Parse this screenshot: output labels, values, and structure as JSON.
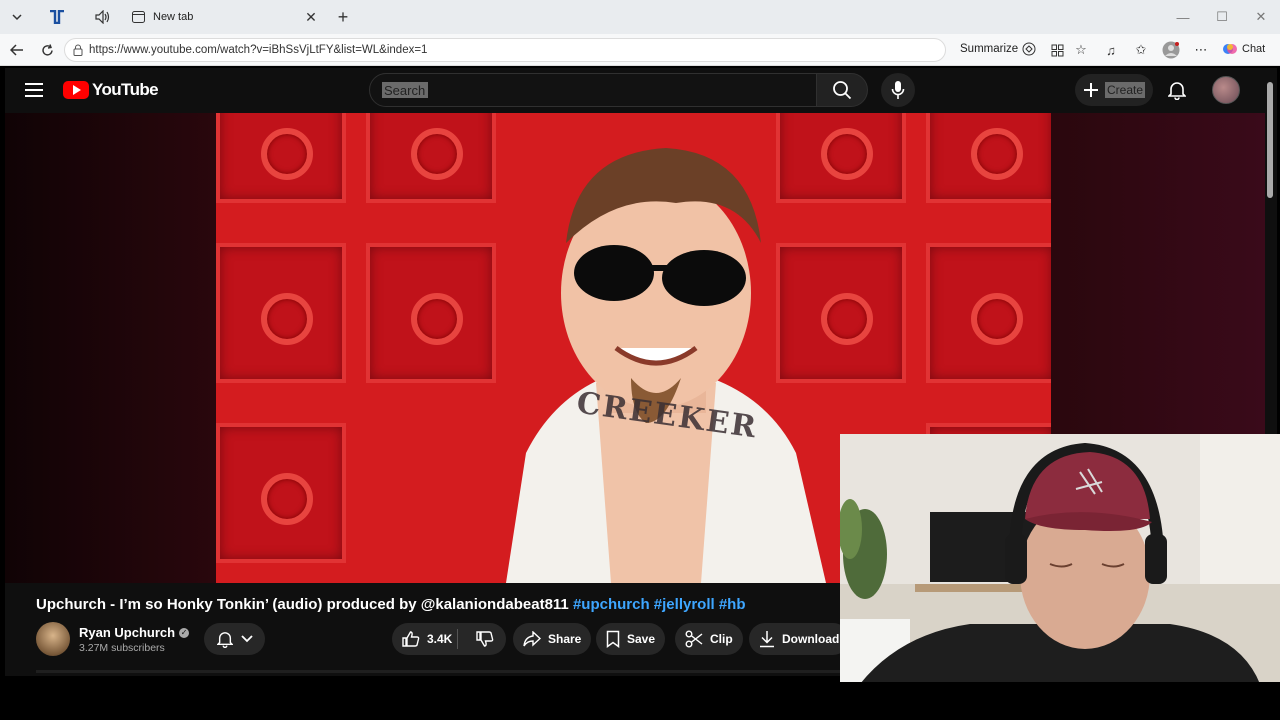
{
  "browser": {
    "tabs": [
      {
        "title": ""
      },
      {
        "title": ""
      },
      {
        "title": "New tab"
      }
    ],
    "url": "https://www.youtube.com/watch?v=iBhSsVjLtFY&list=WL&index=1",
    "summarize_label": "Summarize",
    "chat_label": "Chat"
  },
  "youtube": {
    "logo_text": "YouTube",
    "search_placeholder": "Search",
    "create_label": "Create",
    "video": {
      "title_main": "Upchurch - I’m so Honky Tonkin’ (audio) produced by @kalaniondabeat811",
      "hashtags": [
        "#upchurch",
        "#jellyroll",
        "#hb"
      ],
      "neck_tattoo": "CREEKER"
    },
    "channel": {
      "name": "Ryan Upchurch",
      "subscribers": "3.27M subscribers"
    },
    "actions": {
      "likes": "3.4K",
      "share": "Share",
      "save": "Save",
      "clip": "Clip",
      "download": "Download"
    }
  },
  "colors": {
    "yt_bg": "#0f0f0f",
    "yt_red": "#ff0000",
    "hashtag_blue": "#3ea6ff",
    "door_red": "#d41c1f"
  }
}
